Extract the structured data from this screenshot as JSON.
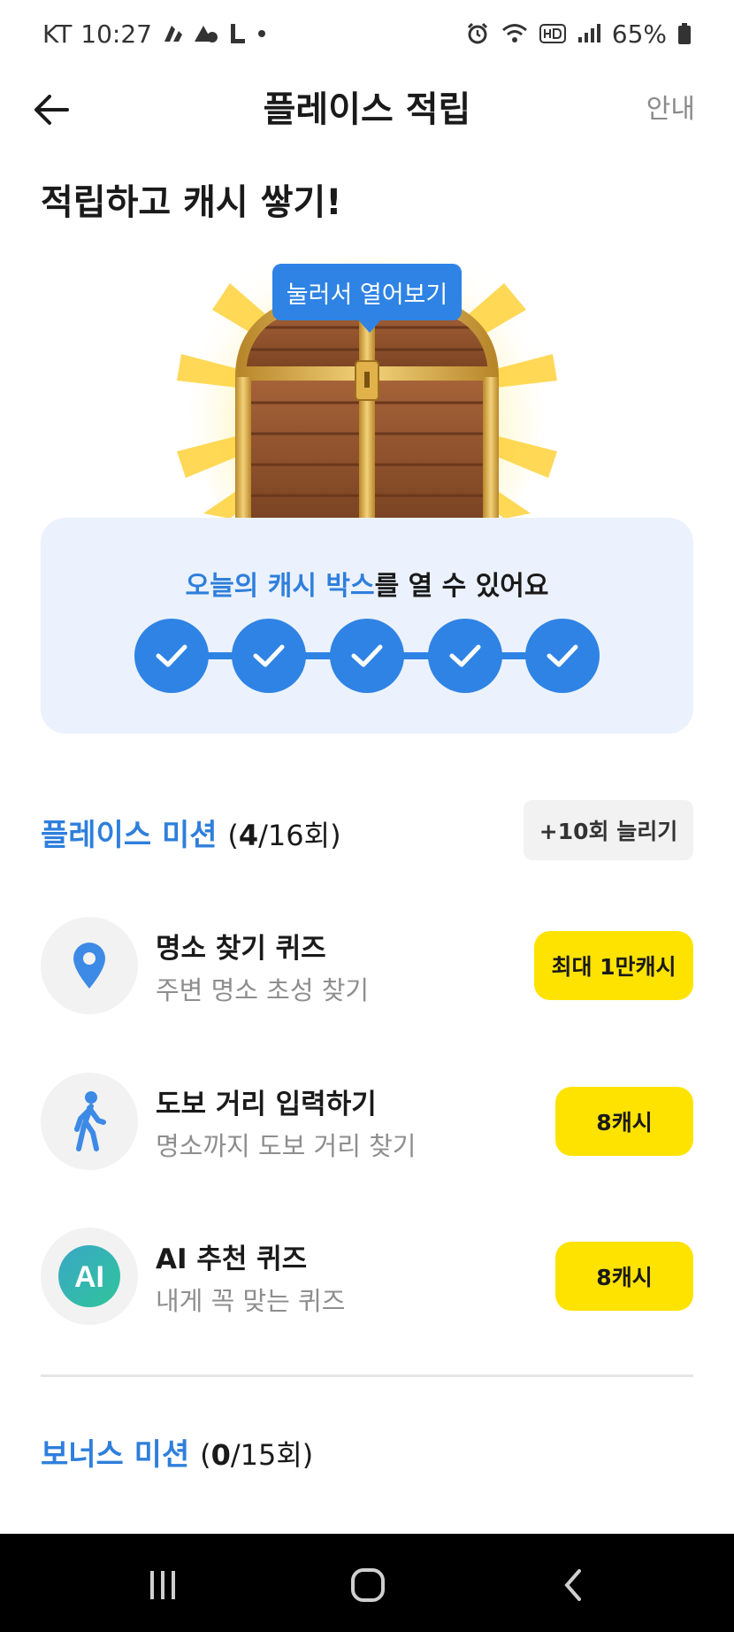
{
  "status_bar": {
    "carrier": "KT",
    "time": "10:27",
    "battery": "65%"
  },
  "header": {
    "title": "플레이스 적립",
    "guide_label": "안내"
  },
  "headline": "적립하고 캐시 쌓기!",
  "chest": {
    "tooltip": "눌러서 열어보기"
  },
  "cash_box": {
    "title_highlight": "오늘의 캐시 박스",
    "title_rest": "를 열 수 있어요",
    "completed_steps": 5,
    "total_steps": 5
  },
  "place_mission": {
    "title": "플레이스 미션",
    "count_open": "(",
    "count_done": "4",
    "count_total": "/16회)",
    "expand_label": "+10회 늘리기",
    "items": [
      {
        "title": "명소 찾기 퀴즈",
        "subtitle": "주변 명소 초성 찾기",
        "reward": "최대 1만캐시",
        "icon": "location-pin-icon"
      },
      {
        "title": "도보 거리 입력하기",
        "subtitle": "명소까지 도보 거리 찾기",
        "reward": "8캐시",
        "icon": "walking-person-icon"
      },
      {
        "title": "AI 추천 퀴즈",
        "subtitle": "내게 꼭 맞는 퀴즈",
        "reward": "8캐시",
        "icon": "ai-badge-icon",
        "icon_text": "AI"
      }
    ]
  },
  "bonus_mission": {
    "title": "보너스 미션",
    "count_open": "(",
    "count_done": "0",
    "count_total": "/15회)"
  },
  "colors": {
    "accent_blue": "#2f83e4",
    "reward_yellow": "#ffe300",
    "card_bg": "#ebf2fd"
  }
}
